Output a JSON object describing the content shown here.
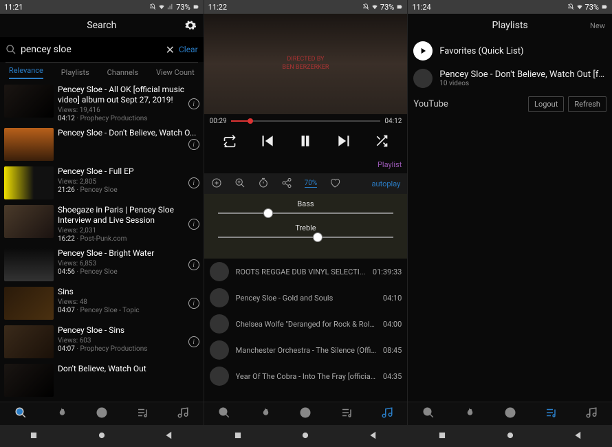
{
  "status": [
    {
      "time": "11:21",
      "battery": "73%"
    },
    {
      "time": "11:22",
      "battery": "73%"
    },
    {
      "time": "11:24",
      "battery": "73%"
    }
  ],
  "search": {
    "header": "Search",
    "query": "pencey sloe",
    "clear": "Clear",
    "tabs": [
      "Relevance",
      "Playlists",
      "Channels",
      "View Count"
    ],
    "results": [
      {
        "title": "Pencey Sloe - All OK [official music video] album out Sept 27, 2019!",
        "views": "19,416",
        "dur": "04:12",
        "src": "Prophecy Productions"
      },
      {
        "title": "Pencey Sloe - Don't Believe, Watch O...",
        "views": "",
        "dur": "",
        "src": ""
      },
      {
        "title": "Pencey Sloe - Full EP",
        "views": "2,805",
        "dur": "21:26",
        "src": "Pencey Sloe"
      },
      {
        "title": "Shoegaze in Paris | Pencey Sloe Interview and Live Session",
        "views": "2,031",
        "dur": "16:22",
        "src": "Post-Punk.com"
      },
      {
        "title": "Pencey Sloe - Bright Water",
        "views": "6,853",
        "dur": "04:56",
        "src": "Pencey Sloe"
      },
      {
        "title": "Sins",
        "views": "48",
        "dur": "04:07",
        "src": "Pencey Sloe - Topic"
      },
      {
        "title": "Pencey Sloe - Sins",
        "views": "603",
        "dur": "04:07",
        "src": "Prophecy Productions"
      },
      {
        "title": "Don't Believe, Watch Out",
        "views": "",
        "dur": "",
        "src": ""
      }
    ]
  },
  "player": {
    "overlay_line1": "DIRECTED BY",
    "overlay_line2": "BEN BERZERKER",
    "pos": "00:29",
    "dur": "04:12",
    "playlist_label": "Playlist",
    "volume_pct": "70%",
    "autoplay": "autoplay",
    "eq": {
      "bass": "Bass",
      "treble": "Treble"
    },
    "queue": [
      {
        "title": "ROOTS REGGAE DUB VINYL SELECTI...",
        "dur": "01:39:33"
      },
      {
        "title": "Pencey Sloe - Gold and Souls",
        "dur": "04:10"
      },
      {
        "title": "Chelsea Wolfe \"Deranged for Rock & Roll\"...",
        "dur": "04:00"
      },
      {
        "title": "Manchester Orchestra - The Silence (Offici...",
        "dur": "08:45"
      },
      {
        "title": "Year Of The Cobra - Into The Fray [official...",
        "dur": "04:35"
      }
    ]
  },
  "playlists": {
    "header": "Playlists",
    "new": "New",
    "items": [
      {
        "title": "Favorites (Quick List)",
        "sub": ""
      },
      {
        "title": "Pencey Sloe - Don't Believe, Watch Out [full",
        "sub": "10 videos"
      }
    ],
    "account": {
      "name": "YouTube",
      "logout": "Logout",
      "refresh": "Refresh"
    }
  }
}
